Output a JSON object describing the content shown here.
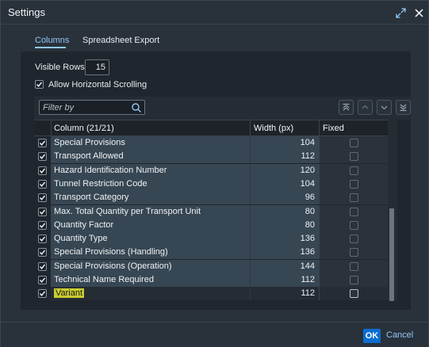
{
  "dialog": {
    "title": "Settings"
  },
  "tabs": [
    {
      "label": "Columns",
      "active": true
    },
    {
      "label": "Spreadsheet Export",
      "active": false
    }
  ],
  "visible_rows": {
    "label": "Visible Rows:",
    "value": "15"
  },
  "horizontal_scrolling": {
    "label": "Allow Horizontal Scrolling",
    "checked": true
  },
  "filter": {
    "placeholder": "Filter by"
  },
  "table": {
    "headers": {
      "column": "Column (21/21)",
      "width": "Width (px)",
      "fixed": "Fixed"
    },
    "rows": [
      {
        "name": "Special Provisions",
        "width": "104",
        "selected": true,
        "fixed": false
      },
      {
        "name": "Transport Allowed",
        "width": "112",
        "selected": true,
        "fixed": false
      },
      {
        "name": "Hazard Identification Number",
        "width": "120",
        "selected": true,
        "fixed": false
      },
      {
        "name": "Tunnel Restriction Code",
        "width": "104",
        "selected": true,
        "fixed": false
      },
      {
        "name": "Transport Category",
        "width": "96",
        "selected": true,
        "fixed": false
      },
      {
        "name": "Max. Total Quantity per Transport Unit",
        "width": "80",
        "selected": true,
        "fixed": false
      },
      {
        "name": "Quantity Factor",
        "width": "80",
        "selected": true,
        "fixed": false
      },
      {
        "name": "Quantity Type",
        "width": "136",
        "selected": true,
        "fixed": false
      },
      {
        "name": "Special Provisions (Handling)",
        "width": "136",
        "selected": true,
        "fixed": false
      },
      {
        "name": "Special Provisions (Operation)",
        "width": "144",
        "selected": true,
        "fixed": false
      },
      {
        "name": "Technical Name Required",
        "width": "112",
        "selected": true,
        "fixed": false
      },
      {
        "name": "Variant",
        "width": "112",
        "selected": true,
        "fixed": false
      }
    ]
  },
  "footer": {
    "ok_label": "OK",
    "cancel_label": "Cancel"
  },
  "colors": {
    "accent": "#91c8f6",
    "primary_button": "#0a6ed1",
    "highlight": "#c9cb2e"
  }
}
